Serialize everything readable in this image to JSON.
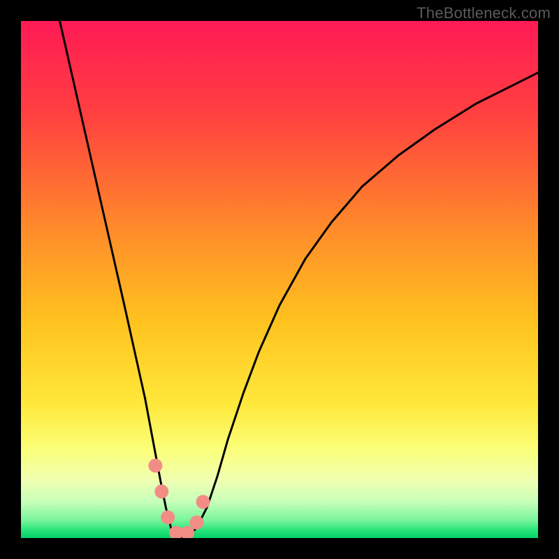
{
  "watermark": "TheBottleneck.com",
  "chart_data": {
    "type": "line",
    "title": "",
    "xlabel": "",
    "ylabel": "",
    "xlim": [
      0,
      100
    ],
    "ylim": [
      0,
      100
    ],
    "grid": false,
    "legend": false,
    "background_gradient_stops": [
      {
        "offset": 0.0,
        "color": "#ff1a55"
      },
      {
        "offset": 0.18,
        "color": "#ff4040"
      },
      {
        "offset": 0.4,
        "color": "#ff8a2a"
      },
      {
        "offset": 0.58,
        "color": "#ffc21f"
      },
      {
        "offset": 0.74,
        "color": "#ffe83a"
      },
      {
        "offset": 0.83,
        "color": "#fbff7a"
      },
      {
        "offset": 0.89,
        "color": "#efffb3"
      },
      {
        "offset": 0.93,
        "color": "#c6ffb9"
      },
      {
        "offset": 0.965,
        "color": "#7af59b"
      },
      {
        "offset": 0.985,
        "color": "#28e47a"
      },
      {
        "offset": 1.0,
        "color": "#02d36a"
      }
    ],
    "series": [
      {
        "name": "bottleneck-curve",
        "color": "#000000",
        "x": [
          7.5,
          10,
          12.5,
          15,
          17.5,
          20,
          22,
          24,
          25.5,
          27,
          28,
          29,
          30,
          31,
          32,
          34,
          36,
          38,
          40,
          43,
          46,
          50,
          55,
          60,
          66,
          73,
          80,
          88,
          96,
          100
        ],
        "y": [
          100,
          89,
          78,
          67,
          56,
          45,
          36,
          27,
          19,
          11,
          6,
          2,
          0,
          0,
          0,
          2,
          6,
          12,
          19,
          28,
          36,
          45,
          54,
          61,
          68,
          74,
          79,
          84,
          88,
          90
        ]
      }
    ],
    "markers": {
      "name": "highlighted-points",
      "color": "#f28d86",
      "radius_px": 10,
      "points": [
        {
          "x": 26.0,
          "y": 14
        },
        {
          "x": 27.2,
          "y": 9
        },
        {
          "x": 28.4,
          "y": 4
        },
        {
          "x": 30.0,
          "y": 1
        },
        {
          "x": 32.2,
          "y": 1
        },
        {
          "x": 34.0,
          "y": 3
        },
        {
          "x": 35.2,
          "y": 7
        }
      ]
    }
  }
}
